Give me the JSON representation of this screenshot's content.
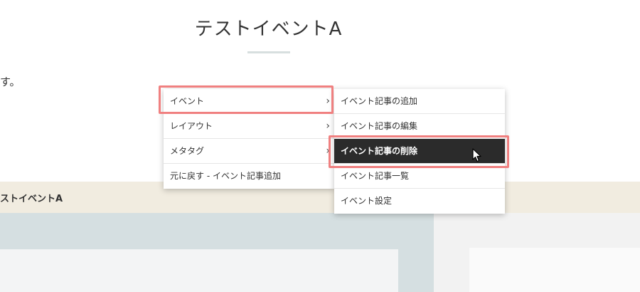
{
  "page": {
    "title": "テストイベントA",
    "stray_text": "す。",
    "bar_label": "ストイベントA"
  },
  "context_menu": {
    "items": [
      {
        "label": "イベント",
        "submenu": true
      },
      {
        "label": "レイアウト",
        "submenu": true
      },
      {
        "label": "メタタグ",
        "submenu": true
      },
      {
        "label": "元に戻す - イベント記事追加",
        "submenu": false
      }
    ],
    "chevron": "›"
  },
  "submenu": {
    "items": [
      {
        "label": "イベント記事の追加"
      },
      {
        "label": "イベント記事の編集"
      },
      {
        "label": "イベント記事の削除",
        "active": true
      },
      {
        "label": "イベント記事一覧"
      },
      {
        "label": "イベント設定"
      }
    ]
  },
  "colors": {
    "highlight": "#f08080",
    "active_item_bg": "#2b2b2b",
    "beige_bar": "#f1ece0",
    "panel_blue_gray": "#d5dfe1"
  },
  "icons": {
    "cursor": "mouse-pointer-icon",
    "chevron": "chevron-right-icon"
  }
}
